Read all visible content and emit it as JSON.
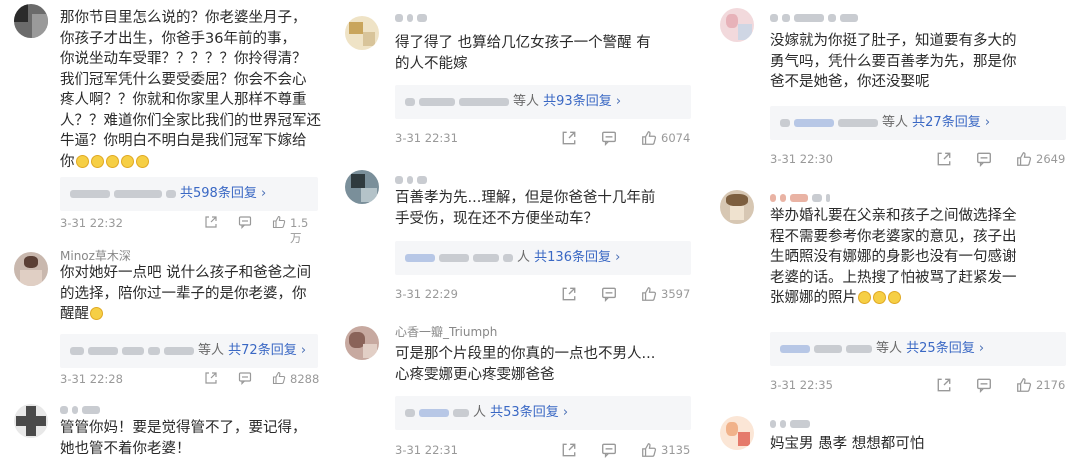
{
  "columns": [
    {
      "comments": [
        {
          "username": "",
          "text_lines": [
            "那你节目里怎么说的？你老婆坐月子，",
            "你孩子才出生，你爸手36年前的事，",
            "你说坐动车受罪？？？？？你拎得清？",
            "我们冠军凭什么要受委屈？你会不会心",
            "疼人啊？？你就和你家里人那样不尊重",
            "人？？难道你们全家比我们的世界冠军还",
            "牛逼？你明白不明白是我们冠军下嫁给",
            "你"
          ],
          "reply_tail": "",
          "reply_count": "共598条回复",
          "time": "3-31 22:32",
          "likes": "1.5万"
        },
        {
          "username": "Minoz草木深",
          "text_lines": [
            "你对她好一点吧 说什么孩子和爸爸之间",
            "的选择，陪你过一辈子的是你老婆，你",
            "醒醒"
          ],
          "reply_tail": "等人",
          "reply_count": "共72条回复",
          "time": "3-31 22:28",
          "likes": "8288"
        },
        {
          "username": "",
          "text_lines": [
            "管管你妈！要是觉得管不了，要记得，",
            "她也管不着你老婆！"
          ]
        }
      ]
    },
    {
      "comments": [
        {
          "username": "",
          "text_lines": [
            "得了得了 也算给几亿女孩子一个警醒 有",
            "的人不能嫁"
          ],
          "reply_tail": "等人",
          "reply_count": "共93条回复",
          "time": "3-31 22:31",
          "likes": "6074"
        },
        {
          "username": "",
          "text_lines": [
            "百善孝为先...理解，但是你爸爸十几年前",
            "手受伤，现在还不方便坐动车？"
          ],
          "reply_tail": "人",
          "reply_count": "共136条回复",
          "time": "3-31 22:29",
          "likes": "3597"
        },
        {
          "username": "心香一瓣_Triumph",
          "text_lines": [
            "可是那个片段里的你真的一点也不男人...",
            "心疼雯娜更心疼雯娜爸爸"
          ],
          "reply_tail": "人",
          "reply_count": "共53条回复",
          "time": "3-31 22:31",
          "likes": "3135"
        }
      ]
    },
    {
      "comments": [
        {
          "username": "",
          "text_lines": [
            "没嫁就为你挺了肚子，知道要有多大的",
            "勇气吗，凭什么要百善孝为先，那是你",
            "爸不是她爸，你还没娶呢"
          ],
          "reply_tail": "等人",
          "reply_count": "共27条回复",
          "time": "3-31 22:30",
          "likes": "2649"
        },
        {
          "username": "",
          "text_lines": [
            "举办婚礼要在父亲和孩子之间做选择全",
            "程不需要参考你老婆家的意见，孩子出",
            "生晒照没有娜娜的身影也没有一句感谢",
            "老婆的话。上热搜了怕被骂了赶紧发一",
            "张娜娜的照片"
          ],
          "reply_tail": "等人",
          "reply_count": "共25条回复",
          "time": "3-31 22:35",
          "likes": "2176"
        },
        {
          "username": "",
          "text_lines": [
            "妈宝男 愚孝 想想都可怕"
          ]
        }
      ]
    }
  ],
  "icons": {
    "share": "share-icon",
    "comment": "comment-icon",
    "like": "thumbs-up-icon",
    "reply_arrow": "chevron-right-icon"
  },
  "colors": {
    "text": "#2a2a2a",
    "meta": "#999999",
    "reply_link": "#3a68c4",
    "reply_bg": "#f5f6f8"
  }
}
